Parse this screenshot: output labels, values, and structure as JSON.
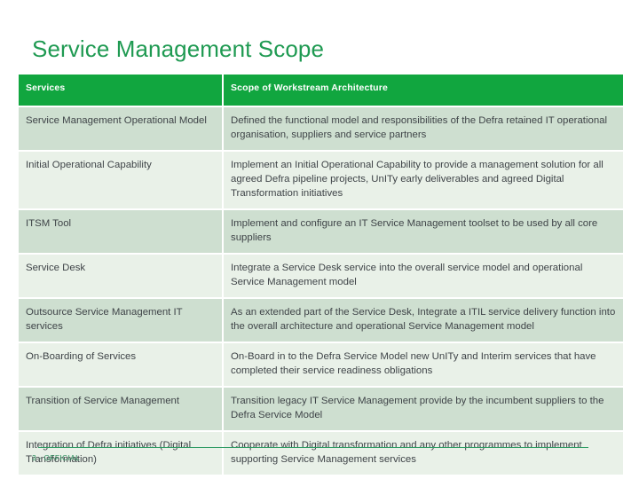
{
  "slide": {
    "title": "Service Management Scope",
    "accent_color": "#11a63f",
    "title_color": "#1f9a52",
    "row_color_a": "#cedfd0",
    "row_color_b": "#e9f1e8",
    "text_color": "#3f4448"
  },
  "table": {
    "headers": {
      "services": "Services",
      "scope": "Scope of Workstream Architecture"
    },
    "rows": [
      {
        "service": "Service Management Operational Model",
        "scope": "Defined the functional model and responsibilities of the Defra retained IT operational organisation, suppliers and service partners"
      },
      {
        "service": "Initial Operational Capability",
        "scope": "Implement an Initial Operational Capability to provide a management solution for all agreed Defra pipeline projects, UnITy early deliverables and agreed Digital Transformation initiatives"
      },
      {
        "service": "ITSM Tool",
        "scope": "Implement and configure an IT Service Management toolset to be used by all core suppliers"
      },
      {
        "service": "Service Desk",
        "scope": "Integrate a Service Desk service into the overall service model and operational Service Management model"
      },
      {
        "service": "Outsource Service Management IT services",
        "scope": "As an extended part of the Service Desk, Integrate a ITIL service delivery function into the overall architecture and operational Service Management model"
      },
      {
        "service": "On-Boarding of Services",
        "scope": "On-Board in to the Defra Service Model new UnITy and Interim services that have completed their service readiness obligations"
      },
      {
        "service": "Transition of Service Management",
        "scope": "Transition legacy IT Service Management provide by the incumbent suppliers to the Defra Service Model"
      },
      {
        "service": "Integration of Defra initiatives (Digital Transformation)",
        "scope": "Cooperate with Digital transformation and any other programmes to implement supporting Service Management services"
      }
    ]
  },
  "footer": {
    "label": "3 - OFFICIAL"
  }
}
